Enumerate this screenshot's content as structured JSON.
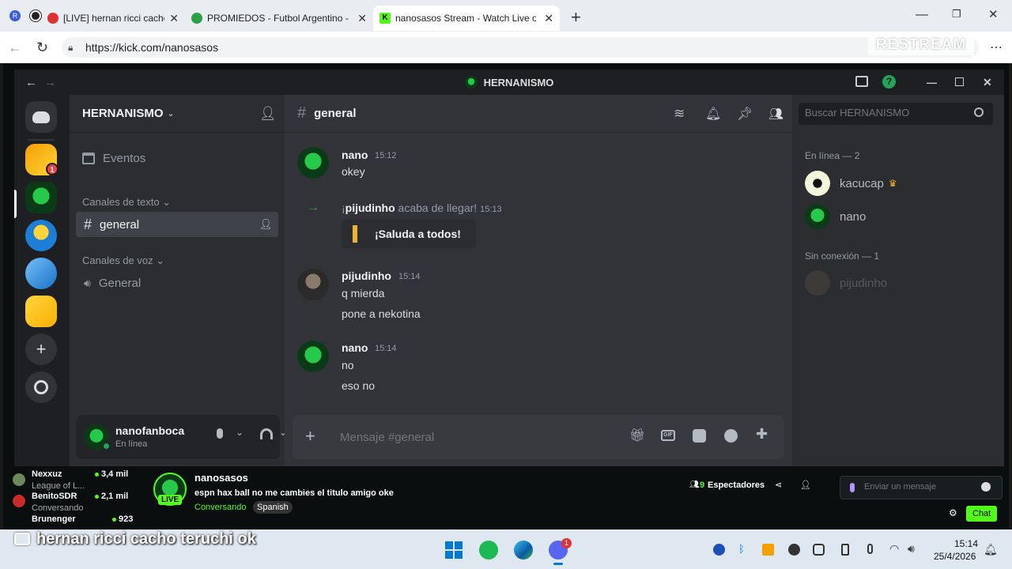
{
  "browser": {
    "tabs": [
      {
        "title": "[LIVE] hernan ricci cacho te",
        "active": false
      },
      {
        "title": "PROMIEDOS - Futbol Argentino -",
        "active": false
      },
      {
        "title": "nanosasos Stream - Watch Live on",
        "active": true
      }
    ],
    "new_tab": "+",
    "url": "https://kick.com/nanosasos",
    "watermark": "RESTREAM"
  },
  "discord": {
    "window_title": "HERNANISMO",
    "server_name": "HERNANISMO",
    "guild_badge": "1",
    "events_label": "Eventos",
    "text_channels_header": "Canales de texto",
    "voice_channels_header": "Canales de voz",
    "text_channel": "general",
    "voice_channel": "General",
    "user": {
      "name": "nanofanboca",
      "status": "En línea"
    },
    "chat_header": "general",
    "search_placeholder": "Buscar HERNANISMO",
    "messages": [
      {
        "author": "nano",
        "time": "15:12",
        "lines": [
          "okey"
        ]
      },
      {
        "join_user": "pijudinho",
        "join_prefix": "¡",
        "join_text": "acaba de llegar!",
        "time": "15:13",
        "button": "¡Saluda a todos!"
      },
      {
        "author": "pijudinho",
        "time": "15:14",
        "lines": [
          "q mierda",
          "pone a nekotina"
        ]
      },
      {
        "author": "nano",
        "time": "15:14",
        "lines": [
          "no",
          "eso no"
        ]
      }
    ],
    "composer_placeholder": "Mensaje #general",
    "online_header": "En línea — 2",
    "offline_header": "Sin conexión — 1",
    "members_online": [
      "kacucap",
      "nano"
    ],
    "members_offline": [
      "pijudinho"
    ]
  },
  "kick": {
    "recommended": [
      {
        "name": "Nexxuz",
        "viewers": "3,4 mil",
        "category": "League of L..."
      },
      {
        "name": "BenitoSDR",
        "viewers": "2,1 mil",
        "category": "Conversando"
      },
      {
        "name": "Brunenger",
        "viewers": "923",
        "category": ""
      }
    ],
    "streamer": "nanosasos",
    "live_badge": "LIVE",
    "stream_title": "espn hax ball no me cambies el titulo amigo oke",
    "category": "Conversando",
    "language": "Spanish",
    "viewers_count": "9",
    "viewers_label": "Espectadores",
    "chat_placeholder": "Enviar un mensaje",
    "chat_button": "Chat"
  },
  "overlay_caption": "hernan ricci cacho teruchi ok",
  "taskbar": {
    "time": "15:14",
    "date": "25/4/2026",
    "discord_badge": "1"
  }
}
